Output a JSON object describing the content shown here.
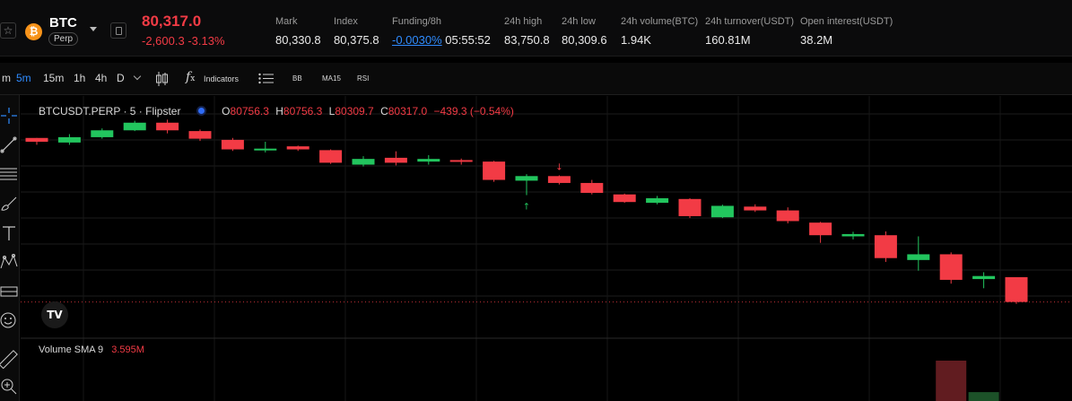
{
  "ticker": {
    "symbol": "BTC",
    "coin_glyph": "₿",
    "contract_type": "Perp",
    "last_price": "80,317.0",
    "change": "-2,600.3 -3.13%",
    "stats": [
      {
        "label": "Mark",
        "value": "80,330.8"
      },
      {
        "label": "Index",
        "value": "80,375.8"
      },
      {
        "label": "Funding/8h",
        "value_link": "-0.0030%",
        "value": "05:55:52"
      },
      {
        "label": "24h high",
        "value": "83,750.8"
      },
      {
        "label": "24h low",
        "value": "80,309.6"
      },
      {
        "label": "24h volume(BTC)",
        "value": "1.94K"
      },
      {
        "label": "24h turnover(USDT)",
        "value": "160.81M"
      },
      {
        "label": "Open interest(USDT)",
        "value": "38.2M"
      }
    ]
  },
  "toolbar": {
    "intervals": [
      "m",
      "5m",
      "15m",
      "1h",
      "4h",
      "D"
    ],
    "active_interval": "5m",
    "indicators_label": "Indicators",
    "studies": [
      "BB",
      "MA15",
      "RSI"
    ]
  },
  "chart": {
    "symbol_label": "BTCUSDT.PERP · 5 · Flipster",
    "ohlc": [
      {
        "key": "O",
        "value": "80756.3"
      },
      {
        "key": "H",
        "value": "80756.3"
      },
      {
        "key": "L",
        "value": "80309.7"
      },
      {
        "key": "C",
        "value": "80317.0"
      }
    ],
    "change": "−439.3 (−0.54%)",
    "volume_label": "Volume SMA 9",
    "volume_value": "3.595M",
    "logo_text": "TV",
    "marker_down": "↓",
    "marker_up": "↑"
  },
  "colors": {
    "up": "#22c55e",
    "down": "#f23b45",
    "accent": "#2f8cff",
    "background": "#000000"
  },
  "chart_data": {
    "type": "candlestick",
    "series": [
      {
        "o": 80870,
        "h": 80870,
        "l": 80852,
        "c": 80860
      },
      {
        "o": 80858,
        "h": 80880,
        "l": 80852,
        "c": 80872
      },
      {
        "o": 80872,
        "h": 80895,
        "l": 80868,
        "c": 80890
      },
      {
        "o": 80890,
        "h": 80915,
        "l": 80888,
        "c": 80910
      },
      {
        "o": 80910,
        "h": 80918,
        "l": 80882,
        "c": 80890
      },
      {
        "o": 80888,
        "h": 80892,
        "l": 80862,
        "c": 80868
      },
      {
        "o": 80865,
        "h": 80870,
        "l": 80836,
        "c": 80840
      },
      {
        "o": 80838,
        "h": 80860,
        "l": 80832,
        "c": 80842
      },
      {
        "o": 80848,
        "h": 80850,
        "l": 80836,
        "c": 80840
      },
      {
        "o": 80838,
        "h": 80840,
        "l": 80802,
        "c": 80805
      },
      {
        "o": 80800,
        "h": 80822,
        "l": 80795,
        "c": 80815
      },
      {
        "o": 80818,
        "h": 80835,
        "l": 80798,
        "c": 80805
      },
      {
        "o": 80808,
        "h": 80825,
        "l": 80800,
        "c": 80815
      },
      {
        "o": 80812,
        "h": 80816,
        "l": 80800,
        "c": 80808
      },
      {
        "o": 80808,
        "h": 80810,
        "l": 80755,
        "c": 80760
      },
      {
        "o": 80758,
        "h": 80775,
        "l": 80720,
        "c": 80770
      },
      {
        "o": 80770,
        "h": 80772,
        "l": 80748,
        "c": 80752
      },
      {
        "o": 80752,
        "h": 80760,
        "l": 80722,
        "c": 80726
      },
      {
        "o": 80722,
        "h": 80724,
        "l": 80700,
        "c": 80702
      },
      {
        "o": 80700,
        "h": 80718,
        "l": 80696,
        "c": 80712
      },
      {
        "o": 80710,
        "h": 80712,
        "l": 80660,
        "c": 80665
      },
      {
        "o": 80662,
        "h": 80695,
        "l": 80660,
        "c": 80692
      },
      {
        "o": 80690,
        "h": 80696,
        "l": 80676,
        "c": 80680
      },
      {
        "o": 80680,
        "h": 80688,
        "l": 80646,
        "c": 80652
      },
      {
        "o": 80648,
        "h": 80650,
        "l": 80595,
        "c": 80615
      },
      {
        "o": 80612,
        "h": 80624,
        "l": 80604,
        "c": 80618
      },
      {
        "o": 80615,
        "h": 80625,
        "l": 80545,
        "c": 80555
      },
      {
        "o": 80550,
        "h": 80612,
        "l": 80522,
        "c": 80565
      },
      {
        "o": 80565,
        "h": 80570,
        "l": 80488,
        "c": 80498
      },
      {
        "o": 80500,
        "h": 80518,
        "l": 80476,
        "c": 80508
      },
      {
        "o": 80505,
        "h": 80505,
        "l": 80435,
        "c": 80440
      }
    ],
    "volume": [
      0,
      0,
      0,
      0,
      0,
      0,
      0,
      0,
      0,
      0,
      0,
      0,
      0,
      0,
      0,
      0,
      0,
      0,
      0,
      0,
      0,
      0,
      0,
      0,
      0,
      0,
      0,
      0,
      1.0,
      0.22,
      0
    ],
    "markers": [
      {
        "index": 16,
        "type": "down"
      },
      {
        "index": 15,
        "type": "up"
      }
    ],
    "last_price_line": 80440,
    "grid": true
  }
}
